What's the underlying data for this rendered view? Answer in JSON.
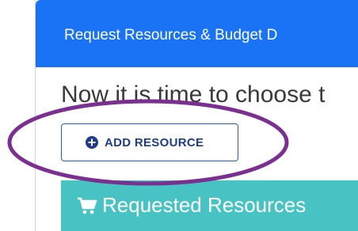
{
  "panel": {
    "title": "Request Resources & Budget D",
    "intro": "Now it is time to choose t"
  },
  "add_resource": {
    "label": "ADD RESOURCE",
    "icon": "plus-circle-icon"
  },
  "requested_resources": {
    "title": "Requested Resources",
    "icon": "shopping-cart-icon"
  },
  "colors": {
    "header_blue": "#1a73f5",
    "teal": "#47c3c3",
    "highlight_purple": "#7b2f91"
  }
}
